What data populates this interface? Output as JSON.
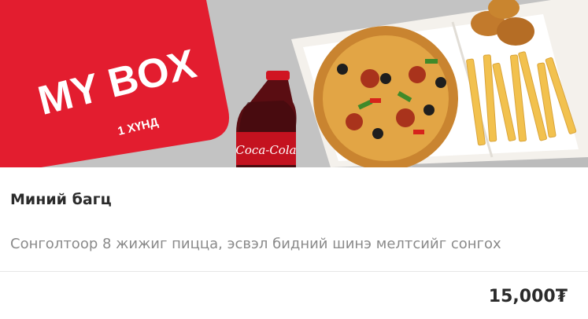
{
  "product": {
    "badge_title": "MY BOX",
    "badge_subtitle": "1 ХҮНД",
    "bottle_brand": "Coca-Cola",
    "title": "Миний багц",
    "description": "Сонголтоор 8 жижиг пицца, эсвэл бидний шинэ мелтсийг сонгох",
    "price": "15,000₮"
  },
  "colors": {
    "badge_red": "#e31d2f",
    "cola_red": "#c4121f",
    "text_dark": "#2b2b2b",
    "text_muted": "#8a8a8a"
  }
}
